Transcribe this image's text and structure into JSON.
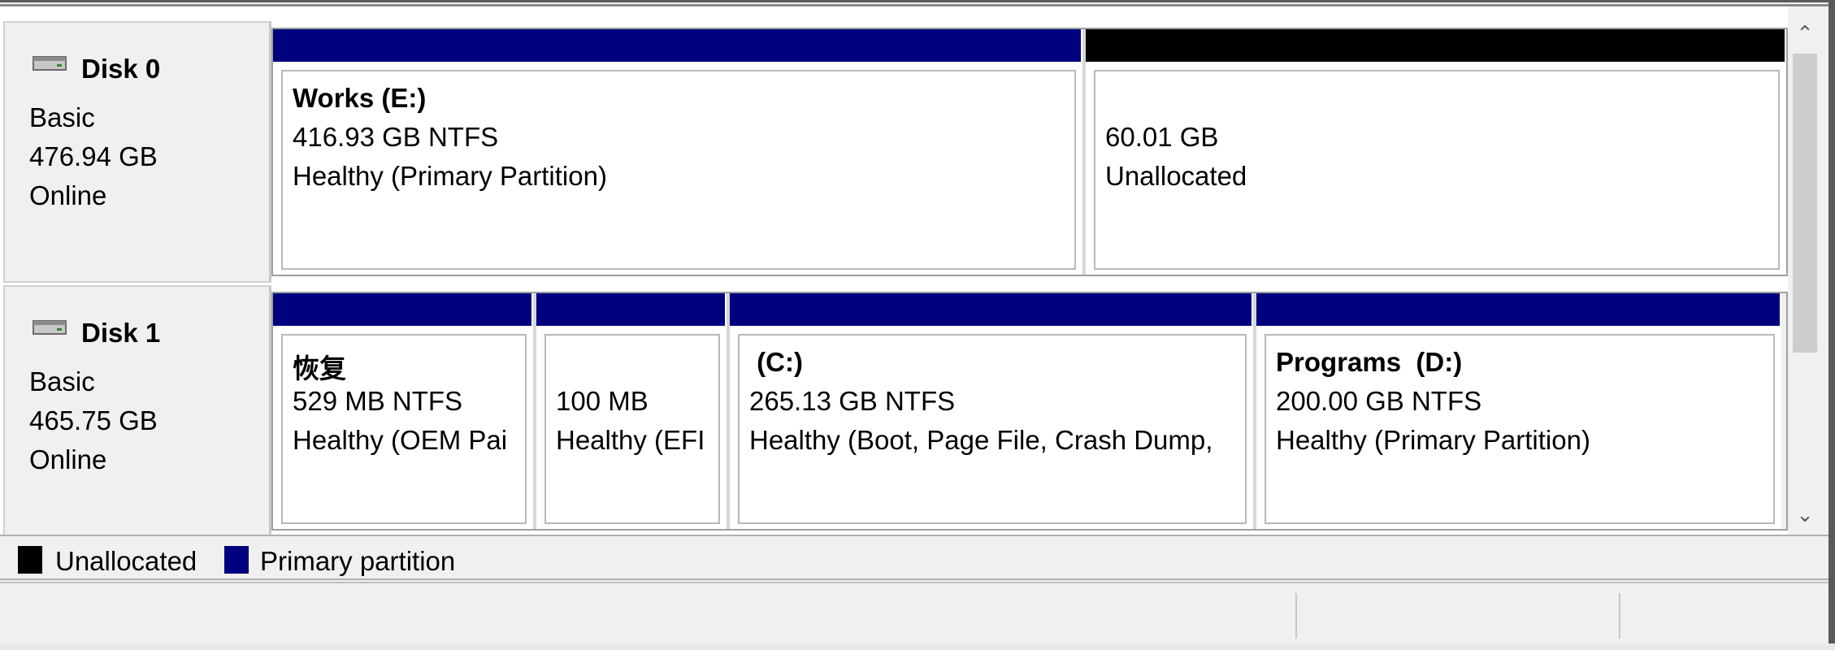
{
  "colors": {
    "primary_partition": "#00007f",
    "unallocated": "#000000"
  },
  "disks": [
    {
      "name": "Disk 0",
      "type": "Basic",
      "size": "476.94 GB",
      "status": "Online",
      "partitions": [
        {
          "kind": "primary",
          "title": "Works  (E:)",
          "size": "416.93 GB NTFS",
          "status": "Healthy (Primary Partition)"
        },
        {
          "kind": "unallocated",
          "title": "",
          "size": "60.01 GB",
          "status": "Unallocated"
        }
      ]
    },
    {
      "name": "Disk 1",
      "type": "Basic",
      "size": "465.75 GB",
      "status": "Online",
      "partitions": [
        {
          "kind": "primary",
          "title": "恢复",
          "size": "529 MB NTFS",
          "status": "Healthy (OEM Pai"
        },
        {
          "kind": "primary",
          "title": "",
          "size": "100 MB",
          "status": "Healthy (EFI"
        },
        {
          "kind": "primary",
          "title": " (C:)",
          "size": "265.13 GB NTFS",
          "status": "Healthy (Boot, Page File, Crash Dump,"
        },
        {
          "kind": "primary",
          "title": "Programs  (D:)",
          "size": "200.00 GB NTFS",
          "status": "Healthy (Primary Partition)"
        }
      ]
    }
  ],
  "legend": [
    {
      "label": "Unallocated",
      "icon": "black-swatch"
    },
    {
      "label": "Primary partition",
      "icon": "blue-swatch"
    }
  ],
  "scrollbar": {
    "up_icon": "chevron-up-icon",
    "down_icon": "chevron-down-icon",
    "up_glyph": "⌃",
    "down_glyph": "⌄"
  }
}
